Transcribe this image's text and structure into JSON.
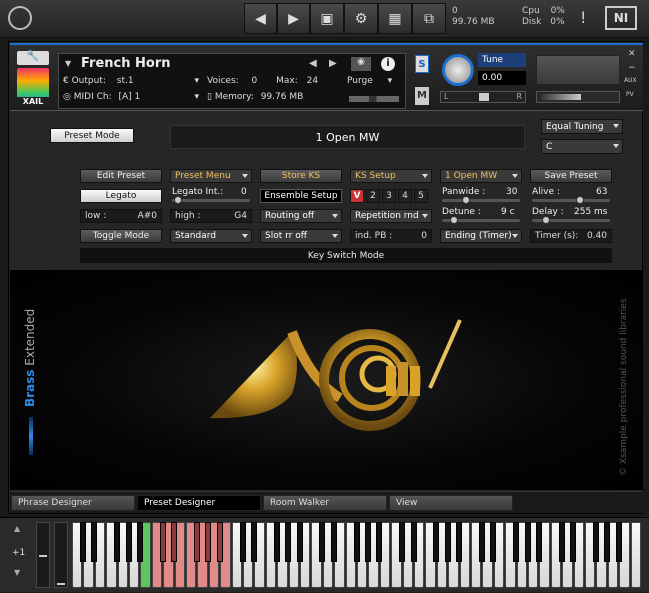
{
  "topbar": {
    "voices_label": "0",
    "memory_label": "99.76 MB",
    "cpu_label": "Cpu",
    "cpu_value": "0%",
    "disk_label": "Disk",
    "disk_value": "0%",
    "warning": "!",
    "ni_logo": "NI"
  },
  "header": {
    "xail_label": "XAIL",
    "instrument_name": "French Horn",
    "output_label": "Output:",
    "output_value": "st.1",
    "voices_label": "Voices:",
    "voices_value": "0",
    "max_label": "Max:",
    "max_value": "24",
    "purge_label": "Purge",
    "midi_label": "MIDI Ch:",
    "midi_value": "[A]  1",
    "memory_label": "Memory:",
    "memory_value": "99.76 MB",
    "s_label": "S",
    "m_label": "M",
    "tune_label": "Tune",
    "tune_value": "0.00",
    "pan_left": "L",
    "pan_right": "R",
    "aux_label": "AUX",
    "pv_label": "PV"
  },
  "controls": {
    "preset_mode": "Preset Mode",
    "preset_display": "1 Open MW",
    "tuning": "Equal Tuning",
    "key": "C",
    "edit_preset": "Edit Preset",
    "preset_menu": "Preset Menu",
    "store_ks": "Store KS",
    "ks_setup": "KS Setup",
    "articulation": "1 Open MW",
    "save_preset": "Save Preset",
    "legato": "Legato",
    "legato_int_label": "Legato Int.:",
    "legato_int_value": "0",
    "ensemble_setup": "Ensemble Setup",
    "ks_v": "V",
    "ks_2": "2",
    "ks_3": "3",
    "ks_4": "4",
    "ks_5": "5",
    "panwide_label": "Panwide :",
    "panwide_value": "30",
    "alive_label": "Alive :",
    "alive_value": "63",
    "low_label": "low :",
    "low_value": "A#0",
    "high_label": "high :",
    "high_value": "G4",
    "routing": "Routing off",
    "repetition": "Repetition rnd",
    "detune_label": "Detune :",
    "detune_value": "9 c",
    "delay_label": "Delay :",
    "delay_value": "255 ms",
    "toggle_mode": "Toggle Mode",
    "standard": "Standard",
    "slot_rr": "Slot rr off",
    "ind_pb_label": "ind. PB :",
    "ind_pb_value": "0",
    "ending": "Ending (Timer)",
    "timer_label": "Timer (s):",
    "timer_value": "0.40",
    "key_switch_mode": "Key Switch Mode"
  },
  "side": {
    "brand_bold": "Brass",
    "brand_light": "Extended",
    "copyright": "© Xsample professional sound libraries"
  },
  "tabs": [
    "Phrase Designer",
    "Preset Designer",
    "Room Walker",
    "View"
  ],
  "keyboard": {
    "octave_label": "+1",
    "colors": {
      "green": "#5ec45e",
      "red": "#e08a8a"
    }
  }
}
